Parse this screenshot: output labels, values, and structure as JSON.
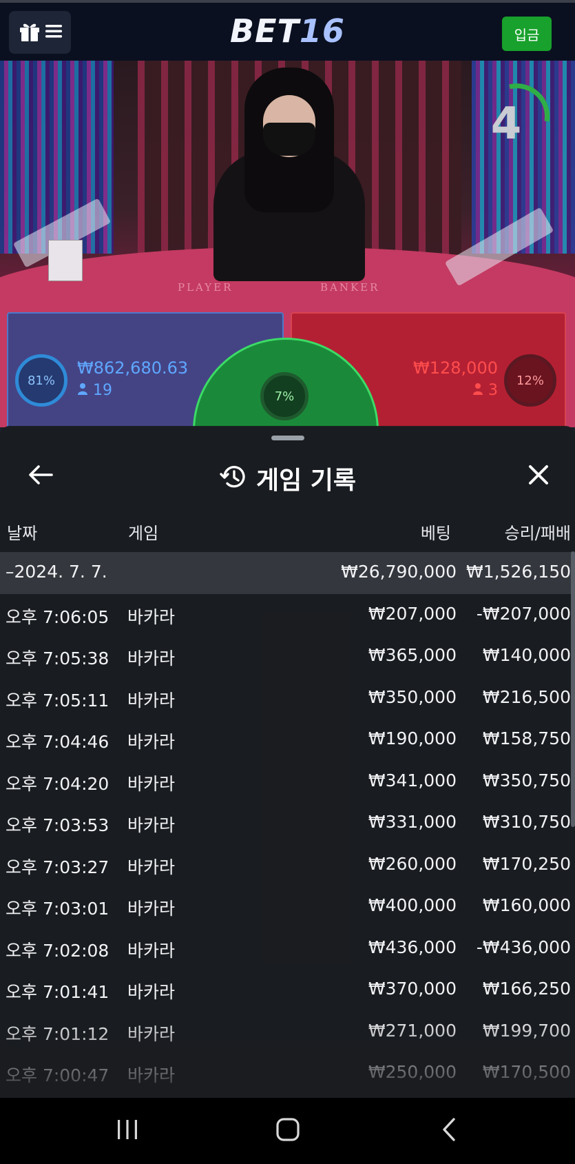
{
  "header": {
    "brand_main": "BET",
    "brand_num": "16",
    "deposit_label": "입금"
  },
  "live": {
    "felt_player": "PLAYER",
    "felt_banker": "BANKER",
    "timer": "4",
    "player": {
      "percent": "81%",
      "amount": "₩862,680.63",
      "count": "19"
    },
    "banker": {
      "percent": "12%",
      "amount": "₩128,000",
      "count": "3"
    },
    "tie": {
      "percent": "7%"
    }
  },
  "history": {
    "title": "게임 기록",
    "columns": {
      "date": "날짜",
      "game": "게임",
      "bet": "베팅",
      "win_loss": "승리/패배"
    },
    "summary": {
      "date": "–2024. 7. 7.",
      "bet": "₩26,790,000",
      "win_loss": "₩1,526,150"
    },
    "rows": [
      {
        "time": "오후 7:06:05",
        "game": "바카라",
        "bet": "₩207,000",
        "win_loss": "-₩207,000"
      },
      {
        "time": "오후 7:05:38",
        "game": "바카라",
        "bet": "₩365,000",
        "win_loss": "₩140,000"
      },
      {
        "time": "오후 7:05:11",
        "game": "바카라",
        "bet": "₩350,000",
        "win_loss": "₩216,500"
      },
      {
        "time": "오후 7:04:46",
        "game": "바카라",
        "bet": "₩190,000",
        "win_loss": "₩158,750"
      },
      {
        "time": "오후 7:04:20",
        "game": "바카라",
        "bet": "₩341,000",
        "win_loss": "₩350,750"
      },
      {
        "time": "오후 7:03:53",
        "game": "바카라",
        "bet": "₩331,000",
        "win_loss": "₩310,750"
      },
      {
        "time": "오후 7:03:27",
        "game": "바카라",
        "bet": "₩260,000",
        "win_loss": "₩170,250"
      },
      {
        "time": "오후 7:03:01",
        "game": "바카라",
        "bet": "₩400,000",
        "win_loss": "₩160,000"
      },
      {
        "time": "오후 7:02:08",
        "game": "바카라",
        "bet": "₩436,000",
        "win_loss": "-₩436,000"
      },
      {
        "time": "오후 7:01:41",
        "game": "바카라",
        "bet": "₩370,000",
        "win_loss": "₩166,250"
      },
      {
        "time": "오후 7:01:12",
        "game": "바카라",
        "bet": "₩271,000",
        "win_loss": "₩199,700"
      },
      {
        "time": "오후 7:00:47",
        "game": "바카라",
        "bet": "₩250,000",
        "win_loss": "₩170,500"
      }
    ]
  },
  "icons": {
    "gift": "gift-icon",
    "menu": "hamburger-icon",
    "back": "arrow-left-icon",
    "history": "history-icon",
    "close": "close-icon",
    "person": "person-icon",
    "recents": "recents-icon",
    "home": "home-icon",
    "nav_back": "chevron-left-icon"
  }
}
